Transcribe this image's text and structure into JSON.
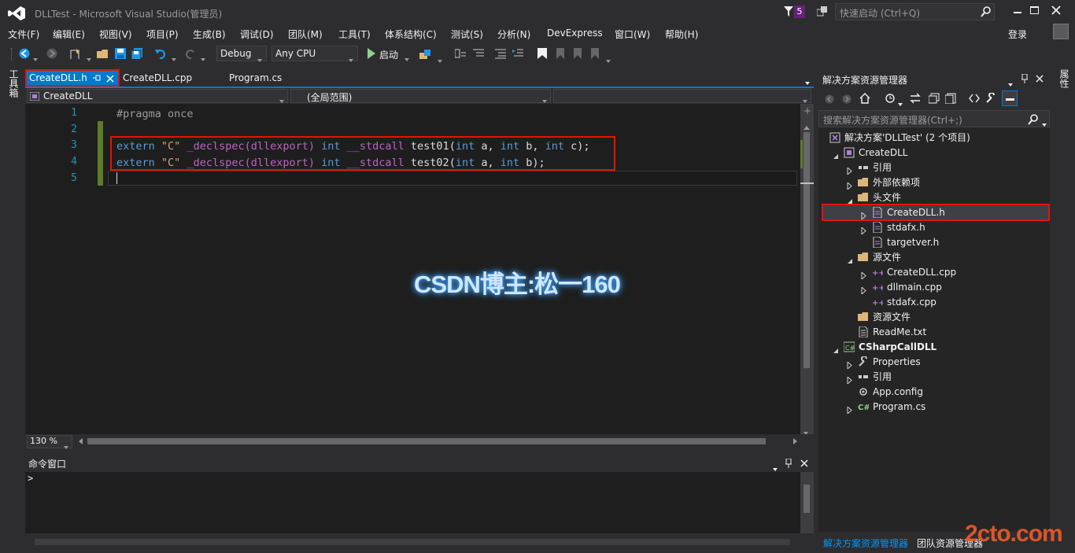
{
  "window": {
    "title": "DLLTest - Microsoft Visual Studio(管理员)",
    "notification_count": "5",
    "quick_launch_placeholder": "快速启动 (Ctrl+Q)",
    "signin": "登录"
  },
  "menu": [
    "文件(F)",
    "编辑(E)",
    "视图(V)",
    "项目(P)",
    "生成(B)",
    "调试(D)",
    "团队(M)",
    "工具(T)",
    "体系结构(C)",
    "测试(S)",
    "分析(N)",
    "DevExpress",
    "窗口(W)",
    "帮助(H)"
  ],
  "toolbar": {
    "config": "Debug",
    "platform": "Any CPU",
    "start_label": "启动"
  },
  "side_labels": {
    "left": "工具箱",
    "right": "属性"
  },
  "editor": {
    "tabs": [
      {
        "label": "CreateDLL.h",
        "active": true
      },
      {
        "label": "CreateDLL.cpp",
        "active": false
      },
      {
        "label": "Program.cs",
        "active": false
      }
    ],
    "nav_left": "CreateDLL",
    "nav_middle": "(全局范围)",
    "line_numbers": [
      "1",
      "2",
      "3",
      "4",
      "5"
    ],
    "lines": [
      [
        {
          "t": "#pragma once",
          "c": "pp"
        }
      ],
      [],
      [
        {
          "t": "extern",
          "c": "kw"
        },
        {
          "t": " ",
          "c": ""
        },
        {
          "t": "\"C\"",
          "c": "str"
        },
        {
          "t": " _declspec(dllexport) ",
          "c": "mc"
        },
        {
          "t": "int",
          "c": "kw"
        },
        {
          "t": " __stdcall ",
          "c": "mc"
        },
        {
          "t": "test01(",
          "c": ""
        },
        {
          "t": "int",
          "c": "kw"
        },
        {
          "t": " a, ",
          "c": ""
        },
        {
          "t": "int",
          "c": "kw"
        },
        {
          "t": " b, ",
          "c": ""
        },
        {
          "t": "int",
          "c": "kw"
        },
        {
          "t": " c);",
          "c": ""
        }
      ],
      [
        {
          "t": "extern",
          "c": "kw"
        },
        {
          "t": " ",
          "c": ""
        },
        {
          "t": "\"C\"",
          "c": "str"
        },
        {
          "t": " _declspec(dllexport) ",
          "c": "mc"
        },
        {
          "t": "int",
          "c": "kw"
        },
        {
          "t": " __stdcall ",
          "c": "mc"
        },
        {
          "t": "test02(",
          "c": ""
        },
        {
          "t": "int",
          "c": "kw"
        },
        {
          "t": " a, ",
          "c": ""
        },
        {
          "t": "int",
          "c": "kw"
        },
        {
          "t": " b);",
          "c": ""
        }
      ],
      []
    ],
    "zoom": "130 %",
    "watermark": "CSDN博主:松一160"
  },
  "command_window": {
    "title": "命令窗口",
    "prompt": ">"
  },
  "solution_explorer": {
    "title": "解决方案资源管理器",
    "search_placeholder": "搜索解决方案资源管理器(Ctrl+;)",
    "items": [
      {
        "label": "解决方案'DLLTest' (2 个项目)",
        "indent": 0,
        "expander": "none",
        "icon": "solution-icon"
      },
      {
        "label": "CreateDLL",
        "indent": 1,
        "expander": "open",
        "icon": "cpp-project-icon"
      },
      {
        "label": "引用",
        "indent": 2,
        "expander": "closed",
        "icon": "references-icon"
      },
      {
        "label": "外部依赖项",
        "indent": 2,
        "expander": "closed",
        "icon": "folder-icon"
      },
      {
        "label": "头文件",
        "indent": 2,
        "expander": "open",
        "icon": "folder-icon"
      },
      {
        "label": "CreateDLL.h",
        "indent": 3,
        "expander": "closed",
        "icon": "header-file-icon",
        "selected": true
      },
      {
        "label": "stdafx.h",
        "indent": 3,
        "expander": "closed",
        "icon": "header-file-icon"
      },
      {
        "label": "targetver.h",
        "indent": 3,
        "expander": "none",
        "icon": "header-file-icon"
      },
      {
        "label": "源文件",
        "indent": 2,
        "expander": "open",
        "icon": "folder-icon"
      },
      {
        "label": "CreateDLL.cpp",
        "indent": 3,
        "expander": "closed",
        "icon": "cpp-file-icon"
      },
      {
        "label": "dllmain.cpp",
        "indent": 3,
        "expander": "closed",
        "icon": "cpp-file-icon"
      },
      {
        "label": "stdafx.cpp",
        "indent": 3,
        "expander": "none",
        "icon": "cpp-file-icon"
      },
      {
        "label": "资源文件",
        "indent": 2,
        "expander": "none",
        "icon": "folder-icon"
      },
      {
        "label": "ReadMe.txt",
        "indent": 2,
        "expander": "none",
        "icon": "text-file-icon"
      },
      {
        "label": "CSharpCallDLL",
        "indent": 1,
        "expander": "open",
        "icon": "csharp-project-icon",
        "bold": true
      },
      {
        "label": "Properties",
        "indent": 2,
        "expander": "closed",
        "icon": "wrench-icon"
      },
      {
        "label": "引用",
        "indent": 2,
        "expander": "closed",
        "icon": "references-icon"
      },
      {
        "label": "App.config",
        "indent": 2,
        "expander": "none",
        "icon": "config-file-icon"
      },
      {
        "label": "Program.cs",
        "indent": 2,
        "expander": "closed",
        "icon": "csharp-file-icon"
      }
    ],
    "bottom_tabs": [
      "解决方案资源管理器",
      "团队资源管理器"
    ]
  },
  "site_watermark": "2cto.com",
  "colors": {
    "accent": "#007acc",
    "highlight_red": "#e51400",
    "keyword": "#569cd6",
    "string": "#d69d85",
    "line_number": "#2b91af"
  }
}
